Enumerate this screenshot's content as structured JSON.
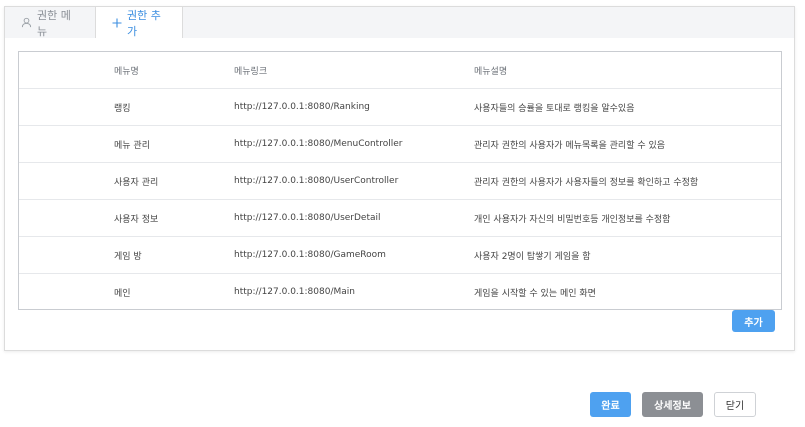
{
  "tabs": {
    "auth_menu": "권한 메뉴",
    "add_auth": "권한 추가"
  },
  "table": {
    "headers": [
      "메뉴명",
      "메뉴링크",
      "메뉴설명"
    ],
    "rows": [
      [
        "랭킹",
        "http://127.0.0.1:8080/Ranking",
        "사용자들의 승률을 토대로 랭킹을 알수있음"
      ],
      [
        "메뉴 관리",
        "http://127.0.0.1:8080/MenuController",
        "관리자 권한의 사용자가 메뉴목록을 관리할 수 있음"
      ],
      [
        "사용자 관리",
        "http://127.0.0.1:8080/UserController",
        "관리자 권한의 사용자가 사용자들의 정보를 확인하고 수정함"
      ],
      [
        "사용자 정보",
        "http://127.0.0.1:8080/UserDetail",
        "개인 사용자가 자신의 비밀번호등 개인정보를 수정함"
      ],
      [
        "게임 방",
        "http://127.0.0.1:8080/GameRoom",
        "사용자 2명이 탑쌓기 게임을 함"
      ],
      [
        "메인",
        "http://127.0.0.1:8080/Main",
        "게임을 시작할 수 있는 메인 화면"
      ]
    ]
  },
  "buttons": {
    "add": "추가",
    "done": "완료",
    "detail": "상세정보",
    "close": "닫기"
  },
  "icons": {
    "tab1": "user-icon",
    "tab2": "plus-icon"
  },
  "colors": {
    "accent": "#4ea1f0",
    "secondary": "#8c8f94",
    "active_tab_text": "#3b8ee0"
  }
}
